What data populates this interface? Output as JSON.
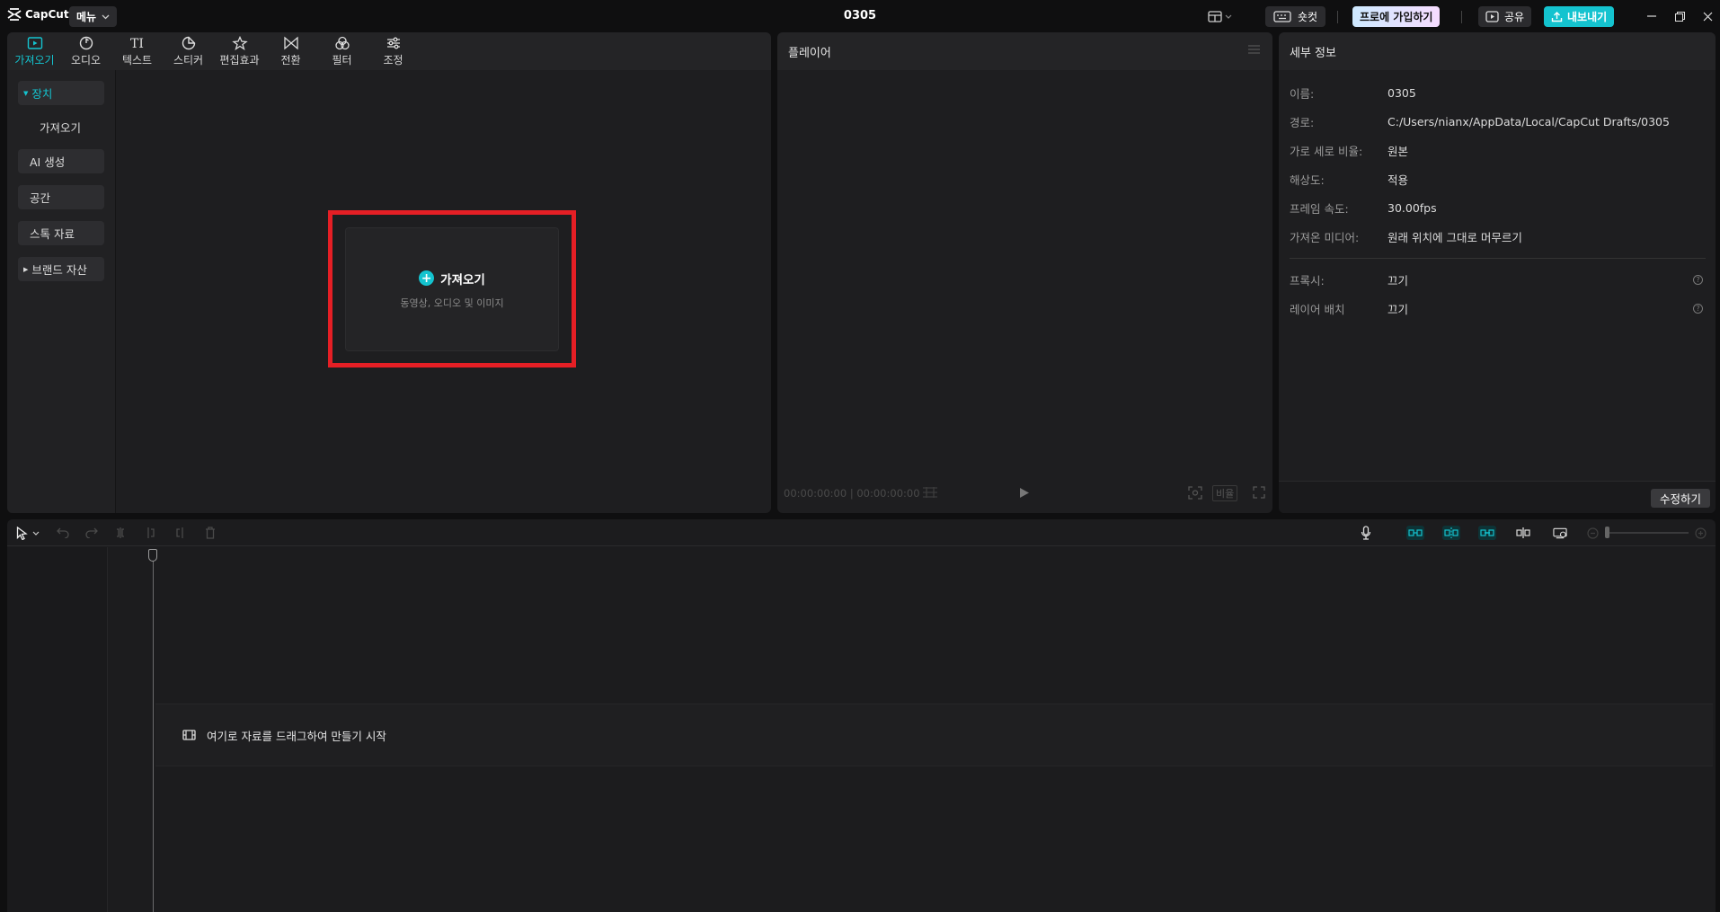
{
  "app": {
    "logo_text": "CapCut",
    "menu_label": "메뉴",
    "doc_title": "0305"
  },
  "topbar": {
    "shortcut_label": "숏컷",
    "pro_label": "프로에 가입하기",
    "share_label": "공유",
    "export_label": "내보내기"
  },
  "media": {
    "tabs": [
      {
        "label": "가져오기",
        "icon": "import-icon"
      },
      {
        "label": "오디오",
        "icon": "audio-icon"
      },
      {
        "label": "텍스트",
        "icon": "text-icon"
      },
      {
        "label": "스티커",
        "icon": "sticker-icon"
      },
      {
        "label": "편집효과",
        "icon": "effects-icon"
      },
      {
        "label": "전환",
        "icon": "transition-icon"
      },
      {
        "label": "필터",
        "icon": "filter-icon"
      },
      {
        "label": "조정",
        "icon": "adjust-icon"
      }
    ],
    "sidebar": {
      "device": "장치",
      "import": "가져오기",
      "ai_generate": "AI 생성",
      "space": "공간",
      "stock": "스톡 자료",
      "brand": "브랜드 자산"
    },
    "import_zone": {
      "title": "가져오기",
      "subtitle": "동영상, 오디오 및 이미지"
    }
  },
  "player": {
    "title": "플레이어",
    "timecode_current": "00:00:00:00",
    "timecode_total": "00:00:00:00",
    "ratio_label": "비율"
  },
  "details": {
    "title": "세부 정보",
    "rows": [
      {
        "label": "이름:",
        "value": "0305"
      },
      {
        "label": "경로:",
        "value": "C:/Users/nianx/AppData/Local/CapCut Drafts/0305"
      },
      {
        "label": "가로 세로 비율:",
        "value": "원본"
      },
      {
        "label": "해상도:",
        "value": "적용"
      },
      {
        "label": "프레임 속도:",
        "value": "30.00fps"
      },
      {
        "label": "가져온 미디어:",
        "value": "원래 위치에 그대로 머무르기"
      }
    ],
    "proxy": {
      "label": "프록시:",
      "value": "끄기"
    },
    "layer": {
      "label": "레이어 배치",
      "value": "끄기"
    },
    "modify_label": "수정하기"
  },
  "timeline": {
    "drop_hint": "여기로 자료를 드래그하여 만들기 시작"
  },
  "colors": {
    "accent": "#14c3cf",
    "highlight_box": "#e51f25"
  }
}
